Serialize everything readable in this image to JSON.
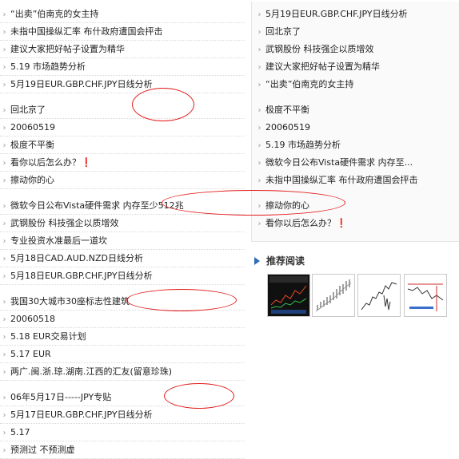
{
  "left_list": [
    {
      "text": "“出卖”伯南克的女主持"
    },
    {
      "text": "未指中国操纵汇率 布什政府遭国会抨击"
    },
    {
      "text": "建议大家把好帖子设置为精华"
    },
    {
      "text": "5.19 市场趋势分析"
    },
    {
      "text": "5月19日EUR.GBP.CHF.JPY日线分析"
    },
    {
      "text": "回北京了"
    },
    {
      "text": "20060519"
    },
    {
      "text": "极度不平衡"
    },
    {
      "text": "看你以后怎么办？❗"
    },
    {
      "text": "擦动你的心"
    },
    {
      "text": "微软今日公布Vista硬件需求  内存至少512兆"
    },
    {
      "text": "武钢股份 科技强企以质增效"
    },
    {
      "text": "专业投资水准最后一道坎"
    },
    {
      "text": "5月18日CAD.AUD.NZD日线分析"
    },
    {
      "text": "5月18日EUR.GBP.CHF.JPY日线分析"
    },
    {
      "text": "我国30大城市30座标志性建筑"
    },
    {
      "text": "20060518"
    },
    {
      "text": "5.18 EUR交易计划"
    },
    {
      "text": "5.17 EUR"
    },
    {
      "text": "两广.闽.浙.琼.湖南.江西的汇友(留意珍珠)"
    },
    {
      "text": "06年5月17日-----JPY专贴"
    },
    {
      "text": "5月17日EUR.GBP.CHF.JPY日线分析"
    },
    {
      "text": "5.17"
    },
    {
      "text": "预测过  不预测虚"
    }
  ],
  "right_list": [
    {
      "text": "5月19日EUR.GBP.CHF.JPY日线分析"
    },
    {
      "text": "回北京了"
    },
    {
      "text": "武钢股份 科技强企以质增效"
    },
    {
      "text": "建议大家把好帖子设置为精华"
    },
    {
      "text": "“出卖”伯南克的女主持"
    },
    {
      "text": "极度不平衡"
    },
    {
      "text": "20060519"
    },
    {
      "text": "5.19 市场趋势分析"
    },
    {
      "text": "微软今日公布Vista硬件需求  内存至..."
    },
    {
      "text": "未指中国操纵汇率 布什政府遭国会抨击"
    },
    {
      "text": "擦动你的心"
    },
    {
      "text": "看你以后怎么办？❗"
    }
  ],
  "recommend": {
    "title": "推荐阅读",
    "thumbnails": [
      {
        "icon": "dark-trading-chart-thumbnail"
      },
      {
        "icon": "candlestick-chart-thumbnail"
      },
      {
        "icon": "line-chart-thumbnail"
      },
      {
        "icon": "indicator-chart-thumbnail"
      }
    ]
  },
  "annotation_color": "#e31b1b",
  "accent_color": "#2f6db5"
}
